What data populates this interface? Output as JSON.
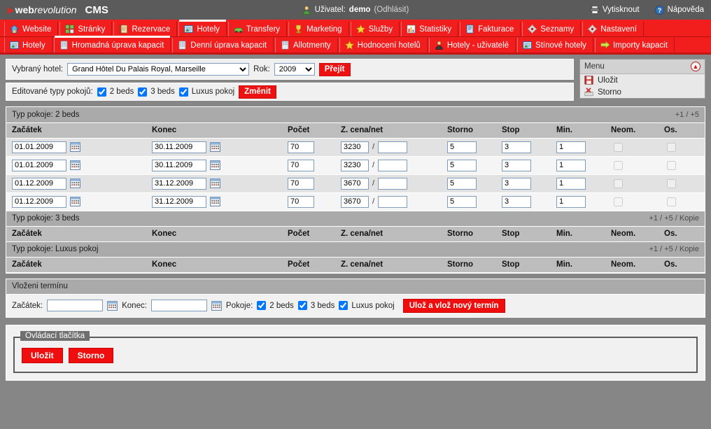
{
  "header": {
    "brand_word": "web",
    "brand_word2": "revolution",
    "brand_cms": "CMS",
    "user_label": "Uživatel:",
    "user_name": "demo",
    "user_logout": "(Odhlásit)",
    "print_label": "Vytisknout",
    "help_label": "Nápověda"
  },
  "mainnav": [
    {
      "label": "Website",
      "icon": "house-icon",
      "active": false
    },
    {
      "label": "Stránky",
      "icon": "pages-icon",
      "active": false
    },
    {
      "label": "Rezervace",
      "icon": "book-icon",
      "active": false
    },
    {
      "label": "Hotely",
      "icon": "hotel-icon",
      "active": true
    },
    {
      "label": "Transfery",
      "icon": "car-icon",
      "active": false
    },
    {
      "label": "Marketing",
      "icon": "trophy-icon",
      "active": false
    },
    {
      "label": "Služby",
      "icon": "star-icon",
      "active": false
    },
    {
      "label": "Statistiky",
      "icon": "chart-icon",
      "active": false
    },
    {
      "label": "Fakturace",
      "icon": "invoice-icon",
      "active": false
    },
    {
      "label": "Seznamy",
      "icon": "gear-icon",
      "active": false
    },
    {
      "label": "Nastavení",
      "icon": "gear-icon",
      "active": false
    }
  ],
  "subnav": [
    {
      "label": "Hotely",
      "icon": "hotel-icon",
      "active": false
    },
    {
      "label": "Hromadná úprava kapacit",
      "icon": "building-icon",
      "active": true
    },
    {
      "label": "Denní úprava kapacit",
      "icon": "building-icon",
      "active": false
    },
    {
      "label": "Allotmenty",
      "icon": "building-icon",
      "active": false
    },
    {
      "label": "Hodnocení hotelů",
      "icon": "star-icon",
      "active": false
    },
    {
      "label": "Hotely - uživatelé",
      "icon": "user-icon",
      "active": false
    },
    {
      "label": "Stínové hotely",
      "icon": "hotel-icon",
      "active": false
    },
    {
      "label": "Importy kapacit",
      "icon": "arrow-right-icon",
      "active": false
    }
  ],
  "selection": {
    "hotel_label": "Vybraný hotel:",
    "hotel_value": "Grand Hôtel Du Palais Royal, Marseille",
    "year_label": "Rok:",
    "year_value": "2009",
    "go_button": "Přejít",
    "roomtypes_label": "Editované typy pokojů:",
    "roomtypes": [
      {
        "label": "2 beds",
        "checked": true
      },
      {
        "label": "3 beds",
        "checked": true
      },
      {
        "label": "Luxus pokoj",
        "checked": true
      }
    ],
    "change_button": "Změnit"
  },
  "menu_panel": {
    "title": "Menu",
    "collapse_icon": "collapse-icon",
    "items": [
      {
        "label": "Uložit",
        "icon": "save-icon"
      },
      {
        "label": "Storno",
        "icon": "cancel-icon"
      }
    ]
  },
  "grid": {
    "columns": [
      "Začátek",
      "Konec",
      "Počet",
      "Z. cena/net",
      "Storno",
      "Stop",
      "Min.",
      "Neom.",
      "Os."
    ],
    "sections": [
      {
        "title": "Typ pokoje: 2 beds",
        "links": "+1 / +5",
        "rows": [
          {
            "start": "01.01.2009",
            "end": "30.11.2009",
            "count": "70",
            "price": "3230",
            "net": "",
            "storno": "5",
            "stop": "3",
            "min": "1",
            "neom": false,
            "os": false
          },
          {
            "start": "01.01.2009",
            "end": "30.11.2009",
            "count": "70",
            "price": "3230",
            "net": "",
            "storno": "5",
            "stop": "3",
            "min": "1",
            "neom": false,
            "os": false
          },
          {
            "start": "01.12.2009",
            "end": "31.12.2009",
            "count": "70",
            "price": "3670",
            "net": "",
            "storno": "5",
            "stop": "3",
            "min": "1",
            "neom": false,
            "os": false
          },
          {
            "start": "01.12.2009",
            "end": "31.12.2009",
            "count": "70",
            "price": "3670",
            "net": "",
            "storno": "5",
            "stop": "3",
            "min": "1",
            "neom": false,
            "os": false
          }
        ]
      },
      {
        "title": "Typ pokoje: 3 beds",
        "links": "+1 / +5 / Kopie",
        "rows": []
      },
      {
        "title": "Typ pokoje: Luxus pokoj",
        "links": "+1 / +5 / Kopie",
        "rows": []
      }
    ]
  },
  "insert": {
    "title": "Vloženi termínu",
    "start_label": "Začátek:",
    "start_value": "",
    "end_label": "Konec:",
    "end_value": "",
    "rooms_label": "Pokoje:",
    "rooms": [
      {
        "label": "2 beds",
        "checked": true
      },
      {
        "label": "3 beds",
        "checked": true
      },
      {
        "label": "Luxus pokoj",
        "checked": true
      }
    ],
    "submit_button": "Ulož a vlož nový termín"
  },
  "controls": {
    "legend": "Ovládací tlačítka",
    "save_button": "Uložit",
    "cancel_button": "Storno"
  },
  "colors": {
    "brand_red": "#f21d1d",
    "header_gray": "#5b5b5b",
    "page_bg": "#868686",
    "panel_bg": "#f1f1f1",
    "section_header": "#aaaaaa",
    "column_header": "#bdbdbd"
  }
}
